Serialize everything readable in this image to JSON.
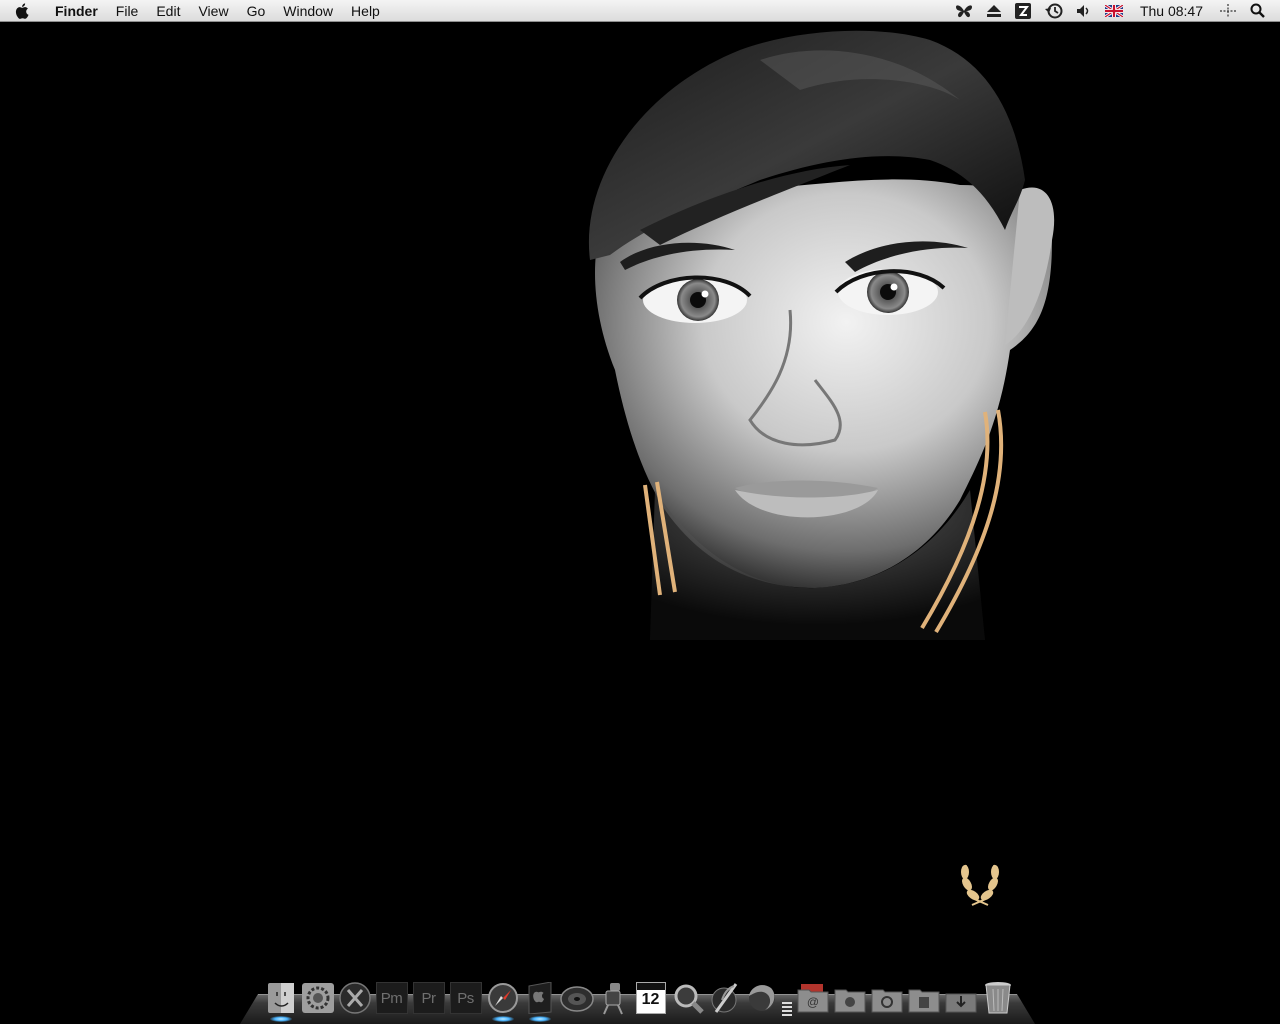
{
  "menubar": {
    "apple_icon": "apple-logo-icon",
    "app_name": "Finder",
    "menus": [
      "File",
      "Edit",
      "View",
      "Go",
      "Window",
      "Help"
    ],
    "status_icons": [
      "butterfly-icon",
      "eject-icon",
      "dashboard-icon",
      "time-machine-icon",
      "volume-icon",
      "uk-flag-icon"
    ],
    "clock": "Thu 08:47",
    "extra_icons": [
      "spaces-icon",
      "spotlight-icon"
    ]
  },
  "dock": {
    "items": [
      {
        "name": "finder",
        "icon": "finder-icon",
        "running": true
      },
      {
        "name": "system-preferences",
        "icon": "gear-icon",
        "running": false
      },
      {
        "name": "x11",
        "icon": "x-icon",
        "running": false
      },
      {
        "name": "pagemaker",
        "icon": "pm-icon",
        "label": "Pm",
        "running": false
      },
      {
        "name": "premiere",
        "icon": "pr-icon",
        "label": "Pr",
        "running": false
      },
      {
        "name": "photoshop",
        "icon": "ps-icon",
        "label": "Ps",
        "running": false
      },
      {
        "name": "safari",
        "icon": "compass-icon",
        "running": true
      },
      {
        "name": "app-store",
        "icon": "apple-box-icon",
        "running": true
      },
      {
        "name": "speaker",
        "icon": "speaker-icon",
        "running": false
      },
      {
        "name": "automator",
        "icon": "robot-icon",
        "running": false
      },
      {
        "name": "ical",
        "icon": "calendar-icon",
        "label": "12",
        "running": false
      },
      {
        "name": "preview",
        "icon": "magnifier-icon",
        "running": false
      },
      {
        "name": "script-editor",
        "icon": "quill-icon",
        "running": false
      },
      {
        "name": "firefox",
        "icon": "globe-icon",
        "running": false
      }
    ],
    "stacks": [
      {
        "name": "mail-folder",
        "icon": "at-folder-icon"
      },
      {
        "name": "applications-folder",
        "icon": "apps-folder-icon"
      },
      {
        "name": "documents-folder",
        "icon": "docs-folder-icon"
      },
      {
        "name": "movies-folder",
        "icon": "film-folder-icon"
      },
      {
        "name": "downloads-folder",
        "icon": "download-folder-icon"
      },
      {
        "name": "trash",
        "icon": "trash-icon"
      }
    ]
  },
  "colors": {
    "menubar_bg": "#e8e8e8",
    "desktop_bg": "#000000",
    "collar_stripe": "#e0b27a",
    "laurel": "#e4c58d",
    "run_light": "#49b4ff"
  }
}
